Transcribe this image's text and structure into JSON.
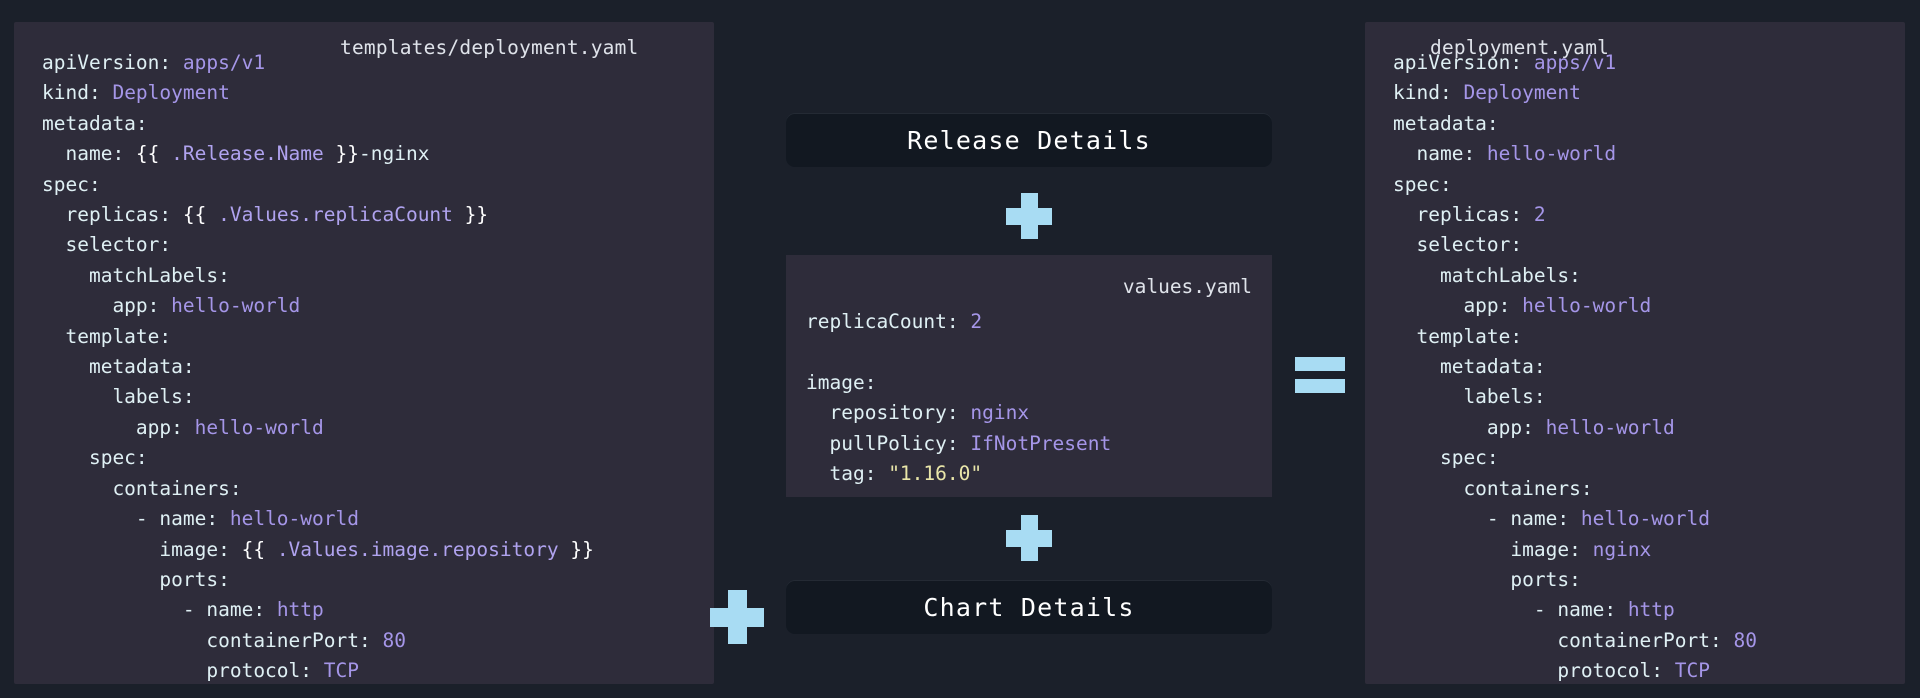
{
  "colors": {
    "page_bg": "#1b202a",
    "panel_bg": "#2e2c3a",
    "pill_bg": "#121821",
    "accent_blue": "#a8dcf3",
    "key_text": "#dff0f4",
    "value_purple": "#a596e8",
    "string_yellow": "#e9e6a9",
    "label_text": "#dfe3ea"
  },
  "left_panel": {
    "file_label": "templates/deployment.yaml",
    "lines": [
      [
        {
          "t": "apiVersion: ",
          "c": "k"
        },
        {
          "t": "apps/v1",
          "c": "v"
        }
      ],
      [
        {
          "t": "kind: ",
          "c": "k"
        },
        {
          "t": "Deployment",
          "c": "v"
        }
      ],
      [
        {
          "t": "metadata:",
          "c": "k"
        }
      ],
      [
        {
          "t": "  name: ",
          "c": "k"
        },
        {
          "t": "{{",
          "c": "br"
        },
        {
          "t": " .Release.Name ",
          "c": "t"
        },
        {
          "t": "}}",
          "c": "br"
        },
        {
          "t": "-nginx",
          "c": "k"
        }
      ],
      [
        {
          "t": "spec:",
          "c": "k"
        }
      ],
      [
        {
          "t": "  replicas: ",
          "c": "k"
        },
        {
          "t": "{{",
          "c": "br"
        },
        {
          "t": " .Values.replicaCount ",
          "c": "t"
        },
        {
          "t": "}}",
          "c": "br"
        }
      ],
      [
        {
          "t": "  selector:",
          "c": "k"
        }
      ],
      [
        {
          "t": "    matchLabels:",
          "c": "k"
        }
      ],
      [
        {
          "t": "      app: ",
          "c": "k"
        },
        {
          "t": "hello-world",
          "c": "v"
        }
      ],
      [
        {
          "t": "  template:",
          "c": "k"
        }
      ],
      [
        {
          "t": "    metadata:",
          "c": "k"
        }
      ],
      [
        {
          "t": "      labels:",
          "c": "k"
        }
      ],
      [
        {
          "t": "        app: ",
          "c": "k"
        },
        {
          "t": "hello-world",
          "c": "v"
        }
      ],
      [
        {
          "t": "    spec:",
          "c": "k"
        }
      ],
      [
        {
          "t": "      containers:",
          "c": "k"
        }
      ],
      [
        {
          "t": "        - name: ",
          "c": "k"
        },
        {
          "t": "hello-world",
          "c": "v"
        }
      ],
      [
        {
          "t": "          image: ",
          "c": "k"
        },
        {
          "t": "{{",
          "c": "br"
        },
        {
          "t": " .Values.image.repository ",
          "c": "t"
        },
        {
          "t": "}}",
          "c": "br"
        }
      ],
      [
        {
          "t": "          ports:",
          "c": "k"
        }
      ],
      [
        {
          "t": "            - name: ",
          "c": "k"
        },
        {
          "t": "http",
          "c": "v"
        }
      ],
      [
        {
          "t": "              containerPort: ",
          "c": "k"
        },
        {
          "t": "80",
          "c": "v"
        }
      ],
      [
        {
          "t": "              protocol: ",
          "c": "k"
        },
        {
          "t": "TCP",
          "c": "v"
        }
      ]
    ]
  },
  "middle": {
    "release_details_label": "Release Details",
    "chart_details_label": "Chart Details",
    "values_file_label": "values.yaml",
    "values_lines": [
      [
        {
          "t": "replicaCount: ",
          "c": "k"
        },
        {
          "t": "2",
          "c": "v"
        }
      ],
      [
        {
          "t": "",
          "c": "k"
        }
      ],
      [
        {
          "t": "image:",
          "c": "k"
        }
      ],
      [
        {
          "t": "  repository: ",
          "c": "k"
        },
        {
          "t": "nginx",
          "c": "v"
        }
      ],
      [
        {
          "t": "  pullPolicy: ",
          "c": "k"
        },
        {
          "t": "IfNotPresent",
          "c": "v"
        }
      ],
      [
        {
          "t": "  tag: ",
          "c": "k"
        },
        {
          "t": "\"1.16.0\"",
          "c": "s"
        }
      ]
    ],
    "plus_icon_top": "plus-icon",
    "plus_icon_bottom": "plus-icon",
    "plus_icon_left": "plus-icon",
    "equals_icon": "equals-icon"
  },
  "right_panel": {
    "file_label": "deployment.yaml",
    "lines": [
      [
        {
          "t": "apiVersion: ",
          "c": "k"
        },
        {
          "t": "apps/v1",
          "c": "v"
        }
      ],
      [
        {
          "t": "kind: ",
          "c": "k"
        },
        {
          "t": "Deployment",
          "c": "v"
        }
      ],
      [
        {
          "t": "metadata:",
          "c": "k"
        }
      ],
      [
        {
          "t": "  name: ",
          "c": "k"
        },
        {
          "t": "hello-world",
          "c": "v"
        }
      ],
      [
        {
          "t": "spec:",
          "c": "k"
        }
      ],
      [
        {
          "t": "  replicas: ",
          "c": "k"
        },
        {
          "t": "2",
          "c": "v"
        }
      ],
      [
        {
          "t": "  selector:",
          "c": "k"
        }
      ],
      [
        {
          "t": "    matchLabels:",
          "c": "k"
        }
      ],
      [
        {
          "t": "      app: ",
          "c": "k"
        },
        {
          "t": "hello-world",
          "c": "v"
        }
      ],
      [
        {
          "t": "  template:",
          "c": "k"
        }
      ],
      [
        {
          "t": "    metadata:",
          "c": "k"
        }
      ],
      [
        {
          "t": "      labels:",
          "c": "k"
        }
      ],
      [
        {
          "t": "        app: ",
          "c": "k"
        },
        {
          "t": "hello-world",
          "c": "v"
        }
      ],
      [
        {
          "t": "    spec:",
          "c": "k"
        }
      ],
      [
        {
          "t": "      containers:",
          "c": "k"
        }
      ],
      [
        {
          "t": "        - name: ",
          "c": "k"
        },
        {
          "t": "hello-world",
          "c": "v"
        }
      ],
      [
        {
          "t": "          image: ",
          "c": "k"
        },
        {
          "t": "nginx",
          "c": "v"
        }
      ],
      [
        {
          "t": "          ports:",
          "c": "k"
        }
      ],
      [
        {
          "t": "            - name: ",
          "c": "k"
        },
        {
          "t": "http",
          "c": "v"
        }
      ],
      [
        {
          "t": "              containerPort: ",
          "c": "k"
        },
        {
          "t": "80",
          "c": "v"
        }
      ],
      [
        {
          "t": "              protocol: ",
          "c": "k"
        },
        {
          "t": "TCP",
          "c": "v"
        }
      ]
    ]
  }
}
